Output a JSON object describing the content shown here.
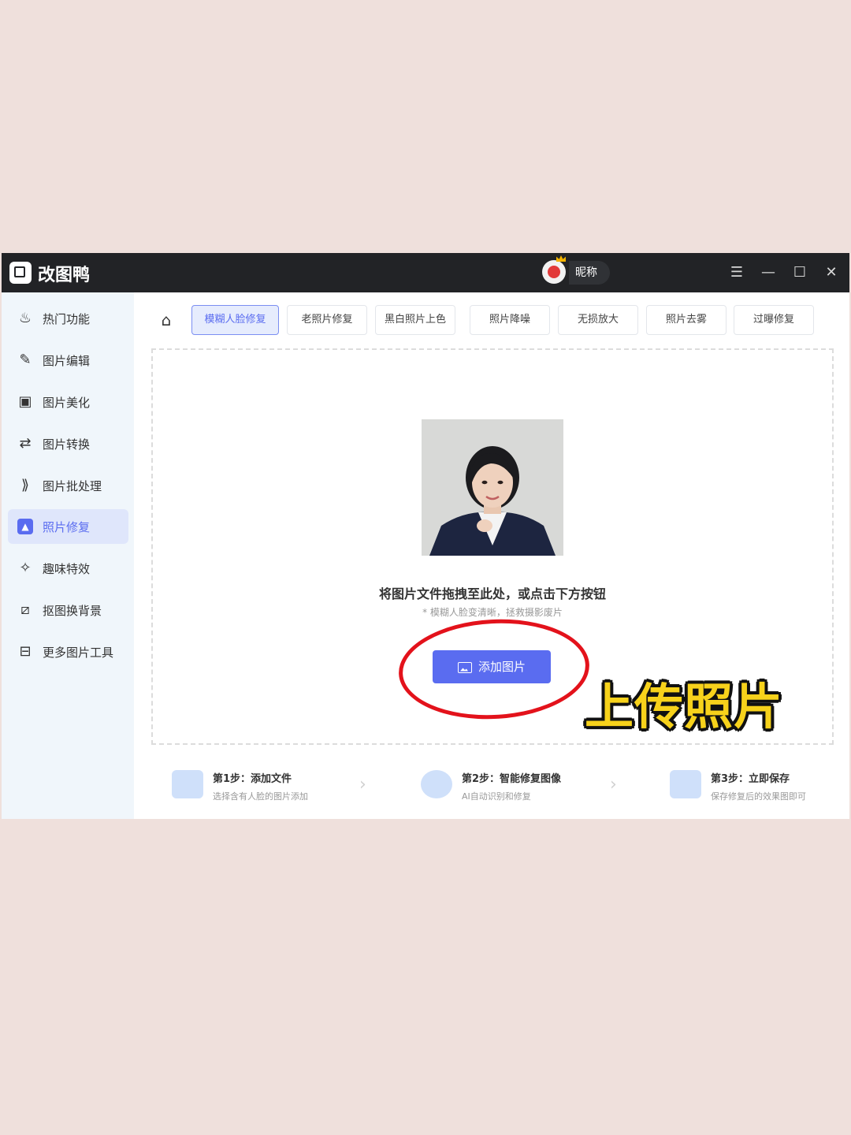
{
  "colors": {
    "accent": "#5a6cf0",
    "annotation_red": "#e3121b",
    "annotation_yellow": "#f7d21b",
    "titlebar": "#222326"
  },
  "titlebar": {
    "app_name": "改图鸭",
    "nickname": "昵称",
    "menu_icon": "menu-icon",
    "min_icon": "minimize-icon",
    "max_icon": "maximize-icon",
    "close_icon": "close-icon"
  },
  "sidebar": {
    "items": [
      {
        "label": "热门功能",
        "icon": "fire-icon"
      },
      {
        "label": "图片编辑",
        "icon": "image-edit-icon"
      },
      {
        "label": "图片美化",
        "icon": "image-beautify-icon"
      },
      {
        "label": "图片转换",
        "icon": "image-convert-icon"
      },
      {
        "label": "图片批处理",
        "icon": "batch-icon"
      },
      {
        "label": "照片修复",
        "icon": "photo-repair-icon",
        "active": true
      },
      {
        "label": "趣味特效",
        "icon": "magic-wand-icon"
      },
      {
        "label": "抠图换背景",
        "icon": "cutout-icon"
      },
      {
        "label": "更多图片工具",
        "icon": "toolbox-icon"
      }
    ]
  },
  "tabs": [
    {
      "label": "模糊人脸修复",
      "active": true
    },
    {
      "label": "老照片修复"
    },
    {
      "label": "黑白照片上色"
    },
    {
      "label": "照片降噪"
    },
    {
      "label": "无损放大"
    },
    {
      "label": "照片去雾"
    },
    {
      "label": "过曝修复"
    }
  ],
  "dropzone": {
    "text": "将图片文件拖拽至此处，或点击下方按钮",
    "hint": "* 模糊人脸变清晰，拯救摄影废片",
    "button": "添加图片"
  },
  "steps": [
    {
      "title": "第1步：添加文件",
      "desc": "选择含有人脸的图片添加"
    },
    {
      "title": "第2步：智能修复图像",
      "desc": "AI自动识别和修复"
    },
    {
      "title": "第3步：立即保存",
      "desc": "保存修复后的效果图即可"
    }
  ],
  "annotation": {
    "text": "上传照片"
  }
}
